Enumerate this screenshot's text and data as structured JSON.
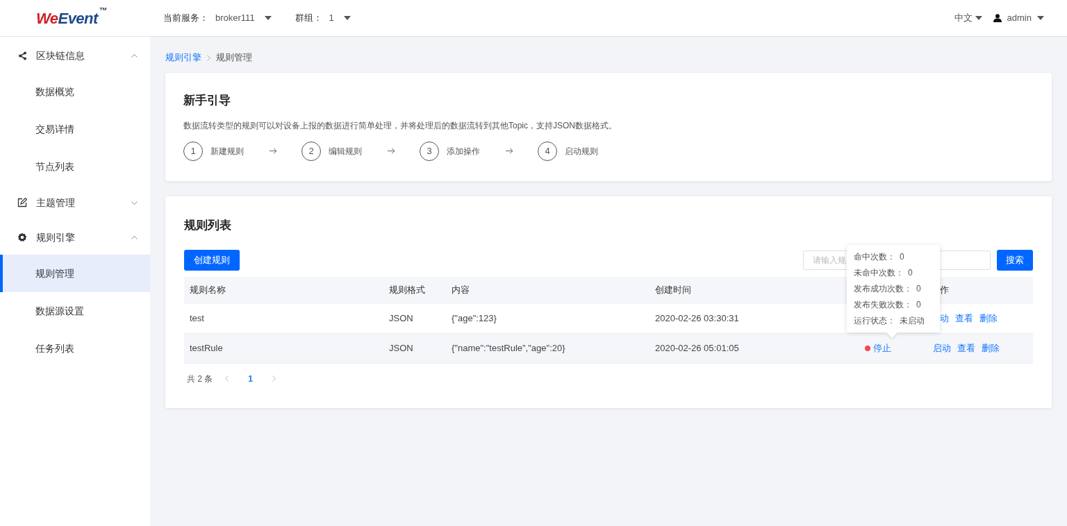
{
  "header": {
    "logo": "WeEvent",
    "logo_mark": "™",
    "service_label": "当前服务：",
    "service_value": "broker111",
    "group_label": "群组：",
    "group_value": "1",
    "language": "中文",
    "user": "admin"
  },
  "sidebar": [
    {
      "label": "区块链信息",
      "expanded": true,
      "children": [
        {
          "label": "数据概览",
          "selected": false
        },
        {
          "label": "交易详情",
          "selected": false
        },
        {
          "label": "节点列表",
          "selected": false
        }
      ]
    },
    {
      "label": "主题管理",
      "expanded": false
    },
    {
      "label": "规则引擎",
      "expanded": true,
      "children": [
        {
          "label": "规则管理",
          "selected": true
        },
        {
          "label": "数据源设置",
          "selected": false
        },
        {
          "label": "任务列表",
          "selected": false
        }
      ]
    }
  ],
  "breadcrumb": [
    "规则引擎",
    "规则管理"
  ],
  "guide": {
    "title": "新手引导",
    "description": "数据流转类型的规则可以对设备上报的数据进行简单处理，并将处理后的数据流转到其他Topic，支持JSON数据格式。",
    "steps": [
      {
        "number": "1",
        "label": "新建规则"
      },
      {
        "number": "2",
        "label": "编辑规则"
      },
      {
        "number": "3",
        "label": "添加操作"
      },
      {
        "number": "4",
        "label": "启动规则"
      }
    ]
  },
  "rules": {
    "title": "规则列表",
    "create_button": "创建规则",
    "search_placeholder": "请输入规",
    "search_button": "搜索",
    "columns": [
      "规则名称",
      "规则格式",
      "内容",
      "创建时间",
      "",
      "作"
    ],
    "rows": [
      {
        "name": "test",
        "format": "JSON",
        "content": "{\"age\":123}",
        "created": "2020-02-26 03:30:31",
        "actions": [
          "动",
          "查看",
          "删除"
        ]
      },
      {
        "name": "testRule",
        "format": "JSON",
        "content": "{\"name\":\"testRule\",\"age\":20}",
        "created": "2020-02-26 05:01:05",
        "status": {
          "label": "停止",
          "color": "#f5484f"
        },
        "actions": [
          "启动",
          "查看",
          "删除"
        ]
      }
    ],
    "pagination": {
      "total": "共 2 条",
      "pages": [
        {
          "label": "1",
          "selected": true
        }
      ]
    },
    "tooltip": [
      {
        "label": "命中次数：",
        "value": "0"
      },
      {
        "label": "未命中次数：",
        "value": "0"
      },
      {
        "label": "发布成功次数：",
        "value": "0"
      },
      {
        "label": "发布失败次数：",
        "value": "0"
      },
      {
        "label": "运行状态：",
        "value": "未启动"
      }
    ]
  }
}
